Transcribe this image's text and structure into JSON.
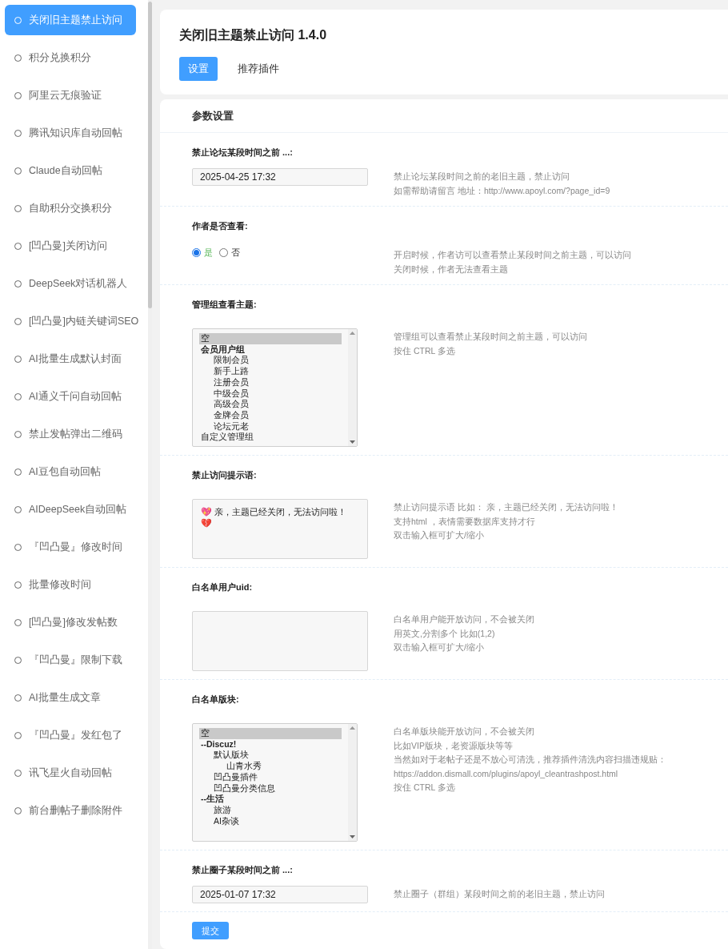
{
  "sidebar": {
    "items": [
      {
        "label": "关闭旧主题禁止访问",
        "selected": true
      },
      {
        "label": "积分兑换积分",
        "selected": false
      },
      {
        "label": "阿里云无痕验证",
        "selected": false
      },
      {
        "label": "腾讯知识库自动回帖",
        "selected": false
      },
      {
        "label": "Claude自动回帖",
        "selected": false
      },
      {
        "label": "自助积分交换积分",
        "selected": false
      },
      {
        "label": "[凹凸曼]关闭访问",
        "selected": false
      },
      {
        "label": "DeepSeek对话机器人",
        "selected": false
      },
      {
        "label": "[凹凸曼]内链关键词SEO",
        "selected": false
      },
      {
        "label": "AI批量生成默认封面",
        "selected": false
      },
      {
        "label": "AI通义千问自动回帖",
        "selected": false
      },
      {
        "label": "禁止发帖弹出二维码",
        "selected": false
      },
      {
        "label": "AI豆包自动回帖",
        "selected": false
      },
      {
        "label": "AIDeepSeek自动回帖",
        "selected": false
      },
      {
        "label": "『凹凸曼』修改时间",
        "selected": false
      },
      {
        "label": "批量修改时间",
        "selected": false
      },
      {
        "label": "[凹凸曼]修改发帖数",
        "selected": false
      },
      {
        "label": "『凹凸曼』限制下载",
        "selected": false
      },
      {
        "label": "AI批量生成文章",
        "selected": false
      },
      {
        "label": "『凹凸曼』发红包了",
        "selected": false
      },
      {
        "label": "讯飞星火自动回帖",
        "selected": false
      },
      {
        "label": "前台删帖子删除附件",
        "selected": false
      }
    ]
  },
  "header": {
    "title": "关闭旧主题禁止访问 1.4.0",
    "tabs": [
      {
        "label": "设置",
        "selected": true
      },
      {
        "label": "推荐插件",
        "selected": false
      }
    ]
  },
  "settings": {
    "title": "参数设置",
    "rows": [
      {
        "kind": "text",
        "label": "禁止论坛某段时间之前 ...:",
        "value": "2025-04-25 17:32",
        "description": [
          "禁止论坛某段时间之前的老旧主题，禁止访问",
          "如需帮助请留言 地址：http://www.apoyl.com/?page_id=9"
        ]
      },
      {
        "kind": "radio",
        "label": "作者是否查看:",
        "options": [
          {
            "label": "是",
            "selected": true
          },
          {
            "label": "否",
            "selected": false
          }
        ],
        "description": [
          "开启时候，作者访可以查看禁止某段时间之前主题，可以访问",
          "关闭时候，作者无法查看主题"
        ]
      },
      {
        "kind": "multiselect",
        "label": "管理组查看主题:",
        "options": [
          {
            "label": "空",
            "selected": true
          },
          {
            "label": "会员用户组",
            "selected": false,
            "children": [
              {
                "label": "限制会员",
                "selected": false
              },
              {
                "label": "新手上路",
                "selected": false
              },
              {
                "label": "注册会员",
                "selected": false
              },
              {
                "label": "中级会员",
                "selected": false
              },
              {
                "label": "高级会员",
                "selected": false
              },
              {
                "label": "金牌会员",
                "selected": false
              },
              {
                "label": "论坛元老",
                "selected": false
              }
            ]
          },
          {
            "label": "自定义管理组",
            "selected": false
          }
        ],
        "description": [
          "管理组可以查看禁止某段时间之前主题，可以访问",
          "按住 CTRL 多选"
        ]
      },
      {
        "kind": "textarea",
        "label": "禁止访问提示语:",
        "value": "💖 亲，主题已经关闭，无法访问啦！ 💔",
        "description": [
          "禁止访问提示语 比如： 亲，主题已经关闭，无法访问啦！",
          "支持html ，表情需要数据库支持才行",
          "双击输入框可扩大/缩小"
        ]
      },
      {
        "kind": "textarea",
        "label": "白名单用户uid:",
        "value": "",
        "description": [
          "白名单用户能开放访问，不会被关闭",
          "用英文,分割多个 比如(1,2)",
          "双击输入框可扩大/缩小"
        ]
      },
      {
        "kind": "multiselect",
        "label": "白名单版块:",
        "options": [
          {
            "label": "空",
            "selected": true
          },
          {
            "label": "--Discuz!",
            "selected": false,
            "children": [
              {
                "label": "默认版块",
                "selected": false,
                "children": [
                  {
                    "label": "山青水秀",
                    "selected": false
                  }
                ]
              },
              {
                "label": "凹凸曼插件",
                "selected": false
              },
              {
                "label": "凹凸曼分类信息",
                "selected": false
              }
            ]
          },
          {
            "label": "--生活",
            "selected": false,
            "children": [
              {
                "label": "旅游",
                "selected": false
              },
              {
                "label": "AI杂谈",
                "selected": false
              }
            ]
          }
        ],
        "description": [
          "白名单版块能开放访问，不会被关闭",
          "比如VIP版块，老资源版块等等",
          "当然如对于老帖子还是不放心可清洗，推荐插件清洗内容扫描违规贴：",
          "https://addon.dismall.com/plugins/apoyl_cleantrashpost.html",
          "按住 CTRL 多选"
        ]
      },
      {
        "kind": "text",
        "label": "禁止圈子某段时间之前 ...:",
        "value": "2025-01-07 17:32",
        "description": [
          "禁止圈子（群组）某段时间之前的老旧主题，禁止访问"
        ]
      }
    ],
    "submit": "提交"
  }
}
